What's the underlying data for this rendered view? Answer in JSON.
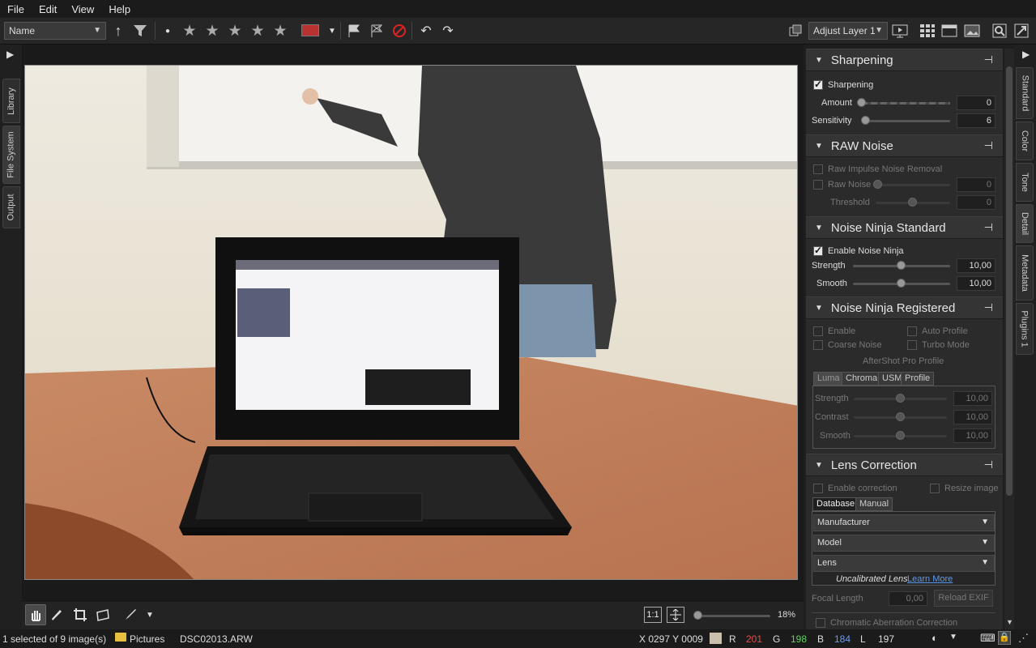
{
  "menu": [
    "File",
    "Edit",
    "View",
    "Help"
  ],
  "toolbar": {
    "sort_value": "Name",
    "layer_value": "Adjust Layer 1",
    "color_label": "#b83232"
  },
  "left_tabs": [
    "Library",
    "File System",
    "Output"
  ],
  "right_tabs": [
    "Standard",
    "Color",
    "Tone",
    "Detail",
    "Metadata",
    "Plugins 1"
  ],
  "panels": {
    "sharpening": {
      "title": "Sharpening",
      "enable": "Sharpening",
      "amount_label": "Amount",
      "amount_value": "0",
      "sensitivity_label": "Sensitivity",
      "sensitivity_value": "6"
    },
    "raw_noise": {
      "title": "RAW Noise",
      "impulse": "Raw Impulse Noise Removal",
      "raw_noise_label": "Raw Noise",
      "raw_noise_value": "0",
      "threshold_label": "Threshold",
      "threshold_value": "0"
    },
    "nn_standard": {
      "title": "Noise Ninja Standard",
      "enable": "Enable Noise Ninja",
      "strength_label": "Strength",
      "strength_value": "10,00",
      "smooth_label": "Smooth",
      "smooth_value": "10,00"
    },
    "nn_registered": {
      "title": "Noise Ninja Registered",
      "enable": "Enable",
      "auto_profile": "Auto Profile",
      "coarse": "Coarse Noise",
      "turbo": "Turbo Mode",
      "profile_caption": "AfterShot Pro Profile",
      "tabs": [
        "Luma",
        "Chroma",
        "USM",
        "Profile"
      ],
      "strength_label": "Strength",
      "strength_value": "10,00",
      "contrast_label": "Contrast",
      "contrast_value": "10,00",
      "smooth_label": "Smooth",
      "smooth_value": "10,00"
    },
    "lens": {
      "title": "Lens Correction",
      "enable": "Enable correction",
      "resize": "Resize image",
      "tabs": [
        "Database",
        "Manual"
      ],
      "manufacturer": "Manufacturer",
      "model": "Model",
      "lens": "Lens",
      "uncalibrated": "Uncalibrated Lens",
      "learn_more": "Learn More",
      "focal_label": "Focal Length",
      "focal_value": "0,00",
      "reload": "Reload EXIF",
      "chromatic": "Chromatic Aberration Correction"
    }
  },
  "bottombar": {
    "one_to_one": "1:1",
    "zoom": "18%",
    "zoom_level": 0.18
  },
  "status": {
    "selection": "1 selected of 9 image(s)",
    "folder": "Pictures",
    "file": "DSC02013.ARW",
    "coords": "X 0297  Y 0009",
    "r_label": "R",
    "r": "201",
    "g_label": "G",
    "g": "198",
    "b_label": "B",
    "b": "184",
    "l_label": "L",
    "l": "197"
  }
}
